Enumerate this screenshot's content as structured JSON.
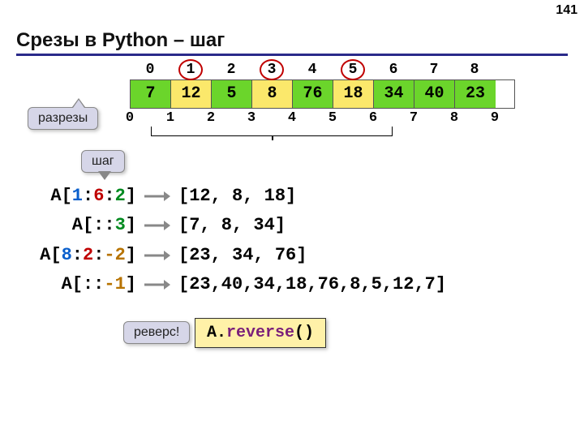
{
  "page_number": "141",
  "title": "Срезы в Python – шаг",
  "array": {
    "top_indices": [
      "0",
      "1",
      "2",
      "3",
      "4",
      "5",
      "6",
      "7",
      "8"
    ],
    "circled_top": [
      1,
      3,
      5
    ],
    "values": [
      "7",
      "12",
      "5",
      "8",
      "76",
      "18",
      "34",
      "40",
      "23"
    ],
    "highlight_yellow": [
      1,
      3,
      5
    ],
    "bottom_indices": [
      "0",
      "1",
      "2",
      "3",
      "4",
      "5",
      "6",
      "7",
      "8",
      "9"
    ]
  },
  "callouts": {
    "cuts": "разрезы",
    "step": "шаг",
    "reverse": "реверс!"
  },
  "examples": [
    {
      "expr_plain": "A[",
      "a": "1",
      "sep1": ":",
      "b": "6",
      "sep2": ":",
      "c": "2",
      "close": "]",
      "result": "[12, 8, 18]"
    },
    {
      "expr_plain": "A[::",
      "c": "3",
      "close": "]",
      "result": "[7, 8, 34]"
    },
    {
      "expr_plain": "A[",
      "a": "8",
      "sep1": ":",
      "b": "2",
      "sep2": ":",
      "c": "-2",
      "close": "]",
      "result": "[23, 34, 76]"
    },
    {
      "expr_plain": "A[::",
      "c": "-1",
      "close": "]",
      "result": "[23,40,34,18,76,8,5,12,7]"
    }
  ],
  "reverse_code": {
    "obj": "A",
    "dot": ".",
    "method": "reverse",
    "paren": "()"
  }
}
